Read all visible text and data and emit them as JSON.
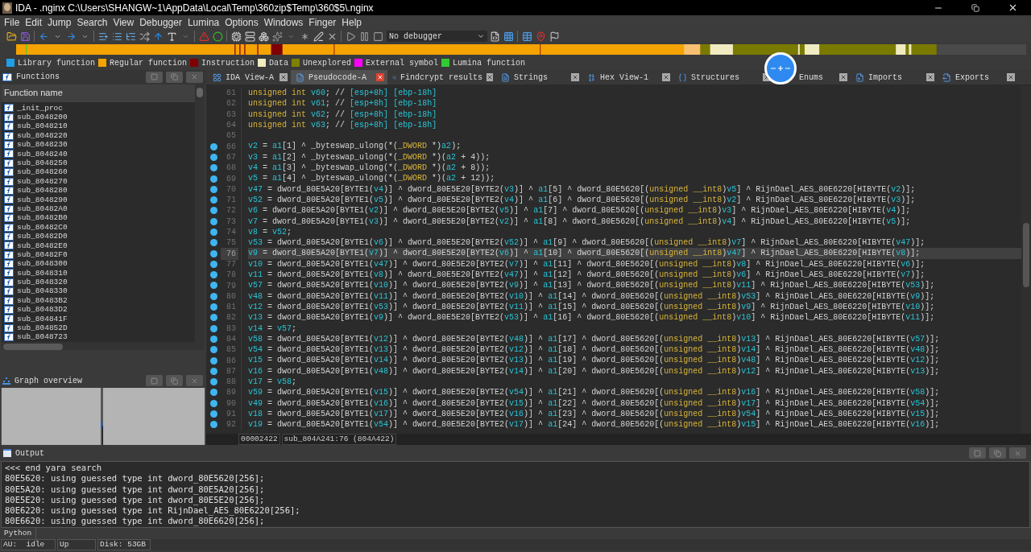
{
  "window": {
    "title": "IDA - .nginx C:\\Users\\SHANGW~1\\AppData\\Local\\Temp\\360zip$Temp\\360$5\\.nginx"
  },
  "menu": [
    "File",
    "Edit",
    "Jump",
    "Search",
    "View",
    "Debugger",
    "Lumina",
    "Options",
    "Windows",
    "Finger",
    "Help"
  ],
  "toolbar": {
    "debugger_select": "No debugger"
  },
  "legend": [
    {
      "label": "Library function",
      "color": "#1e9fe8"
    },
    {
      "label": "Regular function",
      "color": "#f5a300"
    },
    {
      "label": "Instruction",
      "color": "#800000"
    },
    {
      "label": "Data",
      "color": "#f0ebc0"
    },
    {
      "label": "Unexplored",
      "color": "#808000"
    },
    {
      "label": "External symbol",
      "color": "#ff00ff"
    },
    {
      "label": "Lumina function",
      "color": "#33cc33"
    }
  ],
  "functions_panel": {
    "title": "Functions",
    "column": "Function name",
    "items": [
      "_init_proc",
      "sub_8048200",
      "sub_8048210",
      "sub_8048220",
      "sub_8048230",
      "sub_8048240",
      "sub_8048250",
      "sub_8048260",
      "sub_8048270",
      "sub_8048280",
      "sub_8048290",
      "sub_80482A0",
      "sub_80482B0",
      "sub_80482C0",
      "sub_80482D0",
      "sub_80482E0",
      "sub_80482F0",
      "sub_8048300",
      "sub_8048310",
      "sub_8048320",
      "sub_8048330",
      "sub_80483B2",
      "sub_80483D2",
      "sub_804841F",
      "sub_804852D",
      "sub_8048723"
    ]
  },
  "graph_overview": {
    "title": "Graph overview"
  },
  "tabs": [
    {
      "label": "IDA View-A",
      "selected": false
    },
    {
      "label": "Pseudocode-A",
      "selected": true
    },
    {
      "label": "Findcrypt results",
      "selected": false
    },
    {
      "label": "Strings",
      "selected": false
    },
    {
      "label": "Hex View-1",
      "selected": false
    },
    {
      "label": "Structures",
      "selected": false
    },
    {
      "label": "Enums",
      "selected": false
    },
    {
      "label": "Imports",
      "selected": false
    },
    {
      "label": "Exports",
      "selected": false
    }
  ],
  "code": {
    "lines": [
      {
        "number": "61",
        "text": "unsigned int v60; // [esp+8h] [ebp-18h]",
        "breakpoint": false,
        "current": false
      },
      {
        "number": "62",
        "text": "unsigned int v61; // [esp+8h] [ebp-18h]",
        "breakpoint": false,
        "current": false
      },
      {
        "number": "63",
        "text": "unsigned int v62; // [esp+8h] [ebp-18h]",
        "breakpoint": false,
        "current": false
      },
      {
        "number": "64",
        "text": "unsigned int v63; // [esp+8h] [ebp-18h]",
        "breakpoint": false,
        "current": false
      },
      {
        "number": "65",
        "breakpoint": false,
        "current": false
      },
      {
        "number": "66",
        "text": "v2 = a1[1] ^ _byteswap_ulong(*(_DWORD *)a2);",
        "breakpoint": true,
        "current": false
      },
      {
        "number": "67",
        "text": "v3 = a1[2] ^ _byteswap_ulong(*(_DWORD *)(a2 + 4));",
        "breakpoint": true,
        "current": false
      },
      {
        "number": "68",
        "text": "v4 = a1[3] ^ _byteswap_ulong(*(_DWORD *)(a2 + 8));",
        "breakpoint": true,
        "current": false
      },
      {
        "number": "69",
        "text": "v5 = a1[4] ^ _byteswap_ulong(*(_DWORD *)(a2 + 12));",
        "breakpoint": true,
        "current": false
      },
      {
        "number": "70",
        "text": "v47 = dword_80E5A20[BYTE1(v4)] ^ dword_80E5E20[BYTE2(v3)] ^ a1[5] ^ dword_80E5620[(unsigned __int8)v5] ^ RijnDael_AES_80E6220[HIBYTE(v2)];",
        "breakpoint": true,
        "current": false
      },
      {
        "number": "71",
        "text": "v52 = dword_80E5A20[BYTE1(v5)] ^ dword_80E5E20[BYTE2(v4)] ^ a1[6] ^ dword_80E5620[(unsigned __int8)v2] ^ RijnDael_AES_80E6220[HIBYTE(v3)];",
        "breakpoint": true,
        "current": false
      },
      {
        "number": "72",
        "text": "v6 = dword_80E5A20[BYTE1(v2)] ^ dword_80E5E20[BYTE2(v5)] ^ a1[7] ^ dword_80E5620[(unsigned __int8)v3] ^ RijnDael_AES_80E6220[HIBYTE(v4)];",
        "breakpoint": true,
        "current": false
      },
      {
        "number": "73",
        "text": "v7 = dword_80E5A20[BYTE1(v3)] ^ dword_80E5E20[BYTE2(v2)] ^ a1[8] ^ dword_80E5620[(unsigned __int8)v4] ^ RijnDael_AES_80E6220[HIBYTE(v5)];",
        "breakpoint": true,
        "current": false
      },
      {
        "number": "74",
        "text": "v8 = v52;",
        "breakpoint": true,
        "current": false
      },
      {
        "number": "75",
        "text": "v53 = dword_80E5A20[BYTE1(v6)] ^ dword_80E5E20[BYTE2(v52)] ^ a1[9] ^ dword_80E5620[(unsigned __int8)v7] ^ RijnDael_AES_80E6220[HIBYTE(v47)];",
        "breakpoint": true,
        "current": false
      },
      {
        "number": "76",
        "text": "v9 = dword_80E5A20[BYTE1(v7)] ^ dword_80E5E20[BYTE2(v6)] ^ a1[10] ^ dword_80E5620[(unsigned __int8)v47] ^ RijnDael_AES_80E6220[HIBYTE(v8)];",
        "breakpoint": true,
        "current": true
      },
      {
        "number": "77",
        "text": "v10 = dword_80E5A20[BYTE1(v47)] ^ dword_80E5E20[BYTE2(v7)] ^ a1[11] ^ dword_80E5620[(unsigned __int8)v8] ^ RijnDael_AES_80E6220[HIBYTE(v6)];",
        "breakpoint": true,
        "current": false
      },
      {
        "number": "78",
        "text": "v11 = dword_80E5A20[BYTE1(v8)] ^ dword_80E5E20[BYTE2(v47)] ^ a1[12] ^ dword_80E5620[(unsigned __int8)v6] ^ RijnDael_AES_80E6220[HIBYTE(v7)];",
        "breakpoint": true,
        "current": false
      },
      {
        "number": "79",
        "text": "v57 = dword_80E5A20[BYTE1(v10)] ^ dword_80E5E20[BYTE2(v9)] ^ a1[13] ^ dword_80E5620[(unsigned __int8)v11] ^ RijnDael_AES_80E6220[HIBYTE(v53)];",
        "breakpoint": true,
        "current": false
      },
      {
        "number": "80",
        "text": "v48 = dword_80E5A20[BYTE1(v11)] ^ dword_80E5E20[BYTE2(v10)] ^ a1[14] ^ dword_80E5620[(unsigned __int8)v53] ^ RijnDael_AES_80E6220[HIBYTE(v9)];",
        "breakpoint": true,
        "current": false
      },
      {
        "number": "81",
        "text": "v12 = dword_80E5A20[BYTE1(v53)] ^ dword_80E5E20[BYTE2(v11)] ^ a1[15] ^ dword_80E5620[(unsigned __int8)v9] ^ RijnDael_AES_80E6220[HIBYTE(v10)];",
        "breakpoint": true,
        "current": false
      },
      {
        "number": "82",
        "text": "v13 = dword_80E5A20[BYTE1(v9)] ^ dword_80E5E20[BYTE2(v53)] ^ a1[16] ^ dword_80E5620[(unsigned __int8)v10] ^ RijnDael_AES_80E6220[HIBYTE(v11)];",
        "breakpoint": true,
        "current": false
      },
      {
        "number": "83",
        "text": "v14 = v57;",
        "breakpoint": true,
        "current": false
      },
      {
        "number": "84",
        "text": "v58 = dword_80E5A20[BYTE1(v12)] ^ dword_80E5E20[BYTE2(v48)] ^ a1[17] ^ dword_80E5620[(unsigned __int8)v13] ^ RijnDael_AES_80E6220[HIBYTE(v57)];",
        "breakpoint": true,
        "current": false
      },
      {
        "number": "85",
        "text": "v54 = dword_80E5A20[BYTE1(v13)] ^ dword_80E5E20[BYTE2(v12)] ^ a1[18] ^ dword_80E5620[(unsigned __int8)v14] ^ RijnDael_AES_80E6220[HIBYTE(v48)];",
        "breakpoint": true,
        "current": false
      },
      {
        "number": "86",
        "text": "v15 = dword_80E5A20[BYTE1(v14)] ^ dword_80E5E20[BYTE2(v13)] ^ a1[19] ^ dword_80E5620[(unsigned __int8)v48] ^ RijnDael_AES_80E6220[HIBYTE(v12)];",
        "breakpoint": true,
        "current": false
      },
      {
        "number": "87",
        "text": "v16 = dword_80E5A20[BYTE1(v48)] ^ dword_80E5E20[BYTE2(v14)] ^ a1[20] ^ dword_80E5620[(unsigned __int8)v12] ^ RijnDael_AES_80E6220[HIBYTE(v13)];",
        "breakpoint": true,
        "current": false
      },
      {
        "number": "88",
        "text": "v17 = v58;",
        "breakpoint": true,
        "current": false
      },
      {
        "number": "89",
        "text": "v59 = dword_80E5A20[BYTE1(v15)] ^ dword_80E5E20[BYTE2(v54)] ^ a1[21] ^ dword_80E5620[(unsigned __int8)v16] ^ RijnDael_AES_80E6220[HIBYTE(v58)];",
        "breakpoint": true,
        "current": false
      },
      {
        "number": "90",
        "text": "v49 = dword_80E5A20[BYTE1(v16)] ^ dword_80E5E20[BYTE2(v15)] ^ a1[22] ^ dword_80E5620[(unsigned __int8)v17] ^ RijnDael_AES_80E6220[HIBYTE(v54)];",
        "breakpoint": true,
        "current": false
      },
      {
        "number": "91",
        "text": "v18 = dword_80E5A20[BYTE1(v17)] ^ dword_80E5E20[BYTE2(v16)] ^ a1[23] ^ dword_80E5620[(unsigned __int8)v54] ^ RijnDael_AES_80E6220[HIBYTE(v15)];",
        "breakpoint": true,
        "current": false
      },
      {
        "number": "92",
        "text": "v19 = dword_80E5A20[BYTE1(v54)] ^ dword_80E5E20[BYTE2(v17)] ^ a1[24] ^ dword_80E5620[(unsigned __int8)v15] ^ RijnDael_AES_80E6220[HIBYTE(v16)];",
        "breakpoint": true,
        "current": false
      }
    ]
  },
  "code_status": [
    "00002422",
    "sub_804A241:76 (804A422)"
  ],
  "output": {
    "title": "Output",
    "lines": [
      "<<< end yara search",
      "80E5620: using guessed type int dword_80E5620[256];",
      "80E5A20: using guessed type int dword_80E5A20[256];",
      "80E5E20: using guessed type int dword_80E5E20[256];",
      "80E6220: using guessed type int RijnDael_AES_80E6220[256];",
      "80E6620: using guessed type int dword_80E6620[256];"
    ]
  },
  "python_tab": "Python",
  "status_bar": [
    "AU:  idle",
    "Up",
    "Disk: 53GB"
  ]
}
